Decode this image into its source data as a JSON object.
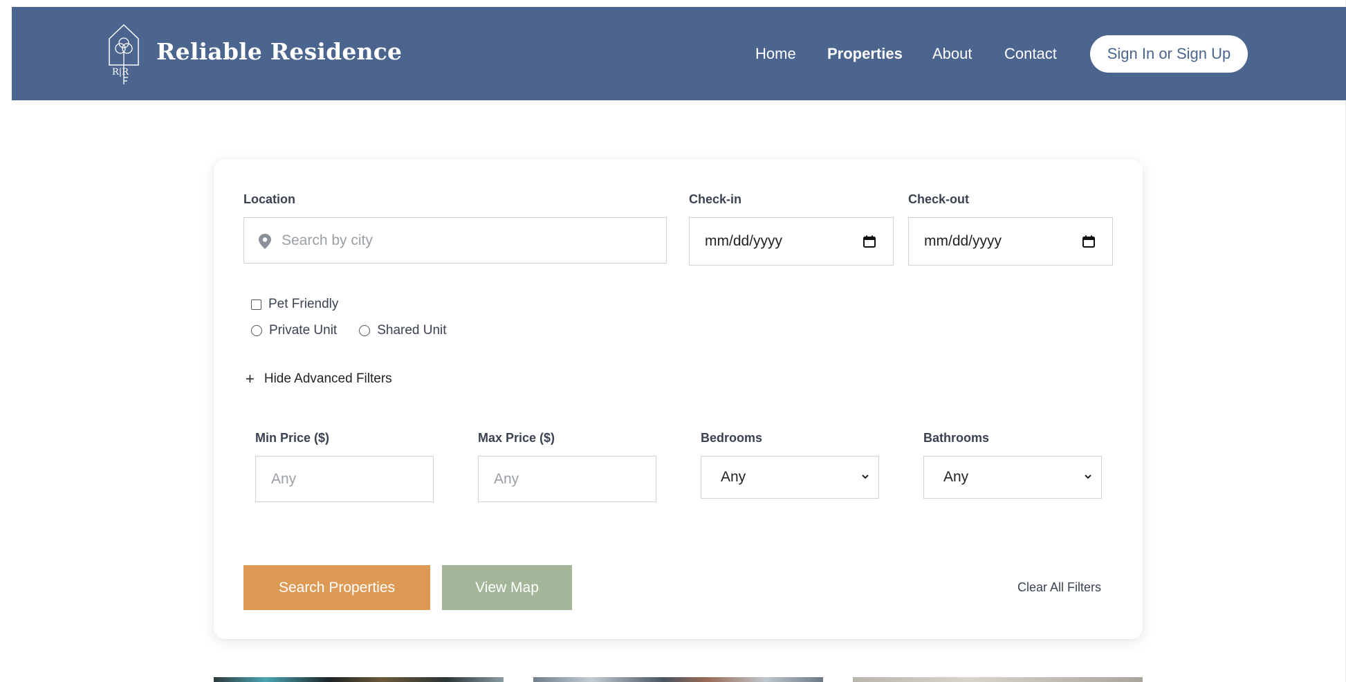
{
  "header": {
    "brand": "Reliable Residence",
    "logo_letters": "R|R",
    "nav": [
      "Home",
      "Properties",
      "About",
      "Contact"
    ],
    "active_nav": "Properties",
    "signin_label": "Sign In or Sign Up"
  },
  "search": {
    "location_label": "Location",
    "location_placeholder": "Search by city",
    "checkin_label": "Check-in",
    "checkin_value": "mm/dd/yyyy",
    "checkout_label": "Check-out",
    "checkout_value": "mm/dd/yyyy",
    "pet_friendly_label": "Pet Friendly",
    "private_unit_label": "Private Unit",
    "shared_unit_label": "Shared Unit",
    "toggle_adv_label": "Hide Advanced Filters",
    "min_price_label": "Min Price ($)",
    "min_price_placeholder": "Any",
    "max_price_label": "Max Price ($)",
    "max_price_placeholder": "Any",
    "bedrooms_label": "Bedrooms",
    "bedrooms_value": "Any",
    "bathrooms_label": "Bathrooms",
    "bathrooms_value": "Any",
    "search_button": "Search Properties",
    "map_button": "View Map",
    "clear_label": "Clear All Filters"
  },
  "colors": {
    "header_bg": "#4b658f",
    "search_button": "#dc9a55",
    "map_button": "#a4b69a"
  }
}
